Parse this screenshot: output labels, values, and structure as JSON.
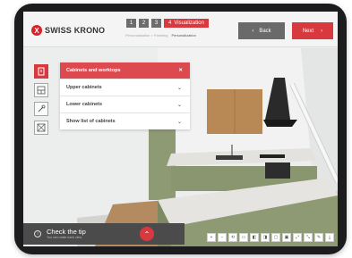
{
  "brand": {
    "logo_text": "SWISS KRONO",
    "logo_mark": "X"
  },
  "steps": {
    "numbers": [
      "1",
      "2",
      "3"
    ],
    "active_number": "4",
    "active_label": "Visualization",
    "sub_left": "Personalisation > Paneling",
    "sub_current": "Personalization"
  },
  "nav": {
    "back_label": "Back",
    "next_label": "Next"
  },
  "tools": [
    "cabinet-icon",
    "layout-icon",
    "brush-icon",
    "texture-icon"
  ],
  "panel": {
    "header": "Cabinets and worktops",
    "items": [
      "Upper cabinets",
      "Lower cabinets",
      "Show list of cabinets"
    ]
  },
  "tip": {
    "title": "Check the tip",
    "subtitle": "You can rotate each view.",
    "button_icon": "chevron-up-icon"
  },
  "controls": [
    "+",
    "−",
    "⟲",
    "▭",
    "◧",
    "◨",
    "▢",
    "▣",
    "⤢",
    "⤡",
    "✎",
    "⤓"
  ],
  "colors": {
    "brand_red": "#d8393f",
    "cabinet_green": "#8e9a74",
    "wood": "#b88954",
    "counter": "#e4e2df"
  }
}
